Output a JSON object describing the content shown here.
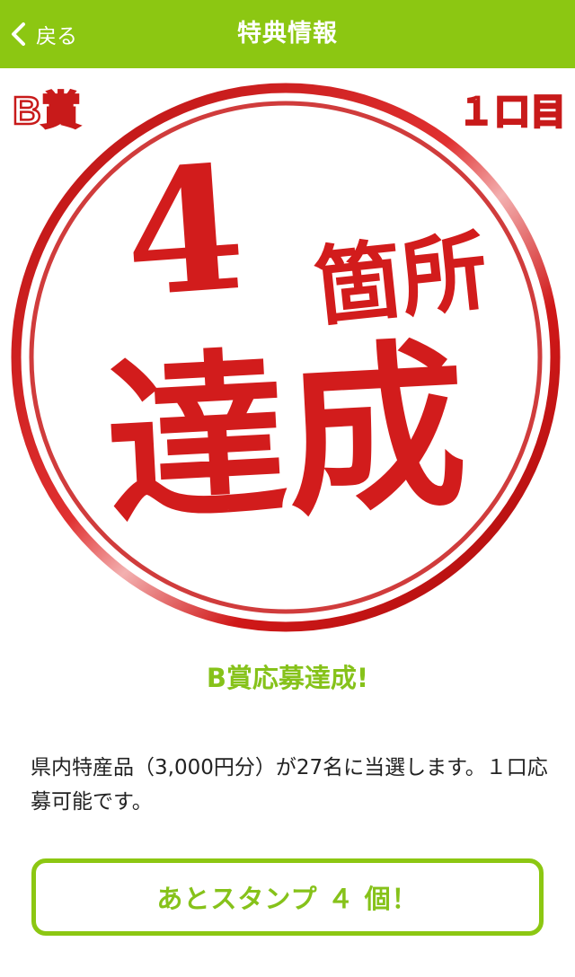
{
  "header": {
    "back_label": "戻る",
    "title": "特典情報"
  },
  "stamp": {
    "prize_label": "B賞",
    "attempt_label": "１口目",
    "count": "4",
    "unit": "箇所",
    "achieved": "達成",
    "color": "#d21c1c"
  },
  "prize": {
    "title": "B賞応募達成!",
    "description": "県内特産品（3,000円分）が27名に当選します。１口応募可能です。"
  },
  "action": {
    "stamp_button_label": "あとスタンプ ４ 個！"
  },
  "colors": {
    "accent": "#8cc712",
    "accent_text": "#86c21a"
  }
}
